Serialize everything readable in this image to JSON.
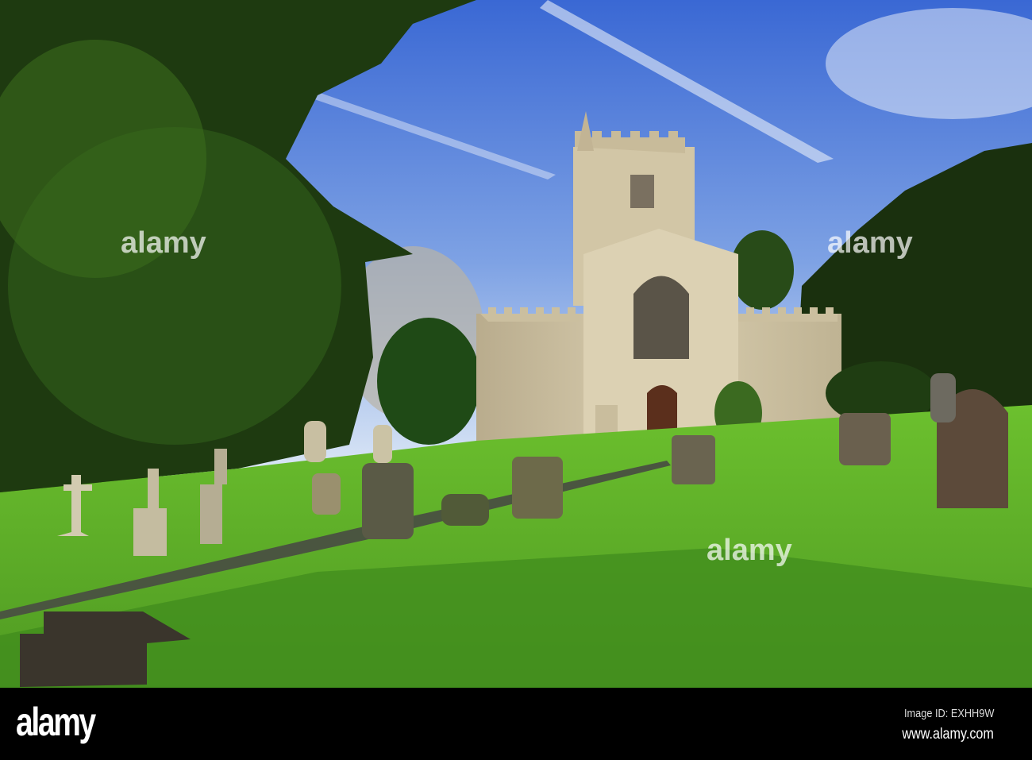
{
  "photo": {
    "subject": "church-in-churchyard",
    "colors": {
      "sky_top": "#3f6fd6",
      "sky_bottom": "#c9dcf2",
      "grass": "#5fb02a",
      "grass_shadow": "#2f6a12",
      "stone": "#cfc3a3",
      "tree_dark": "#1c3410"
    }
  },
  "watermark": {
    "text": "alamy"
  },
  "footer": {
    "logo": "alamy",
    "image_id": "Image ID: EXHH9W",
    "site": "www.alamy.com"
  }
}
